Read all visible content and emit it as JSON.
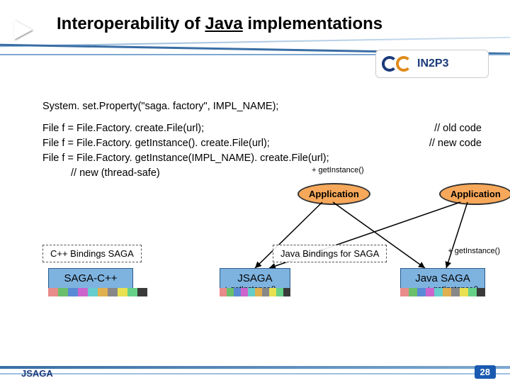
{
  "title": {
    "pre": "Interoperability of ",
    "und": "Java",
    "post": " implementations"
  },
  "logo_text": "IN2P3",
  "code": {
    "l1": "System. set.Property(\"saga. factory\", IMPL_NAME);",
    "l2a": "File f = File.Factory. create.File(url);",
    "l2b": "// old code",
    "l3a": "File f = File.Factory. getInstance(). create.File(url);",
    "l3b": "// new code",
    "l4a": "File f = File.Factory. getInstance(IMPL_NAME). create.File(url);",
    "l4b": "// new (thread-safe)"
  },
  "labels": {
    "get_instance": "+ getInstance()",
    "application": "Application",
    "cpp_bindings": "C++ Bindings SAGA",
    "java_bindings": "Java Bindings for SAGA",
    "saga_cpp": "SAGA-C++",
    "jsaga": "JSAGA",
    "java_saga": "Java SAGA"
  },
  "footer": {
    "left": "JSAGA",
    "page": "28"
  },
  "palette": [
    "#e88b8b",
    "#6bbf6b",
    "#5a8ad6",
    "#cc66cc",
    "#66cccc",
    "#e0b050",
    "#888",
    "#e8e050",
    "#66d088",
    "#3a3a3a"
  ]
}
